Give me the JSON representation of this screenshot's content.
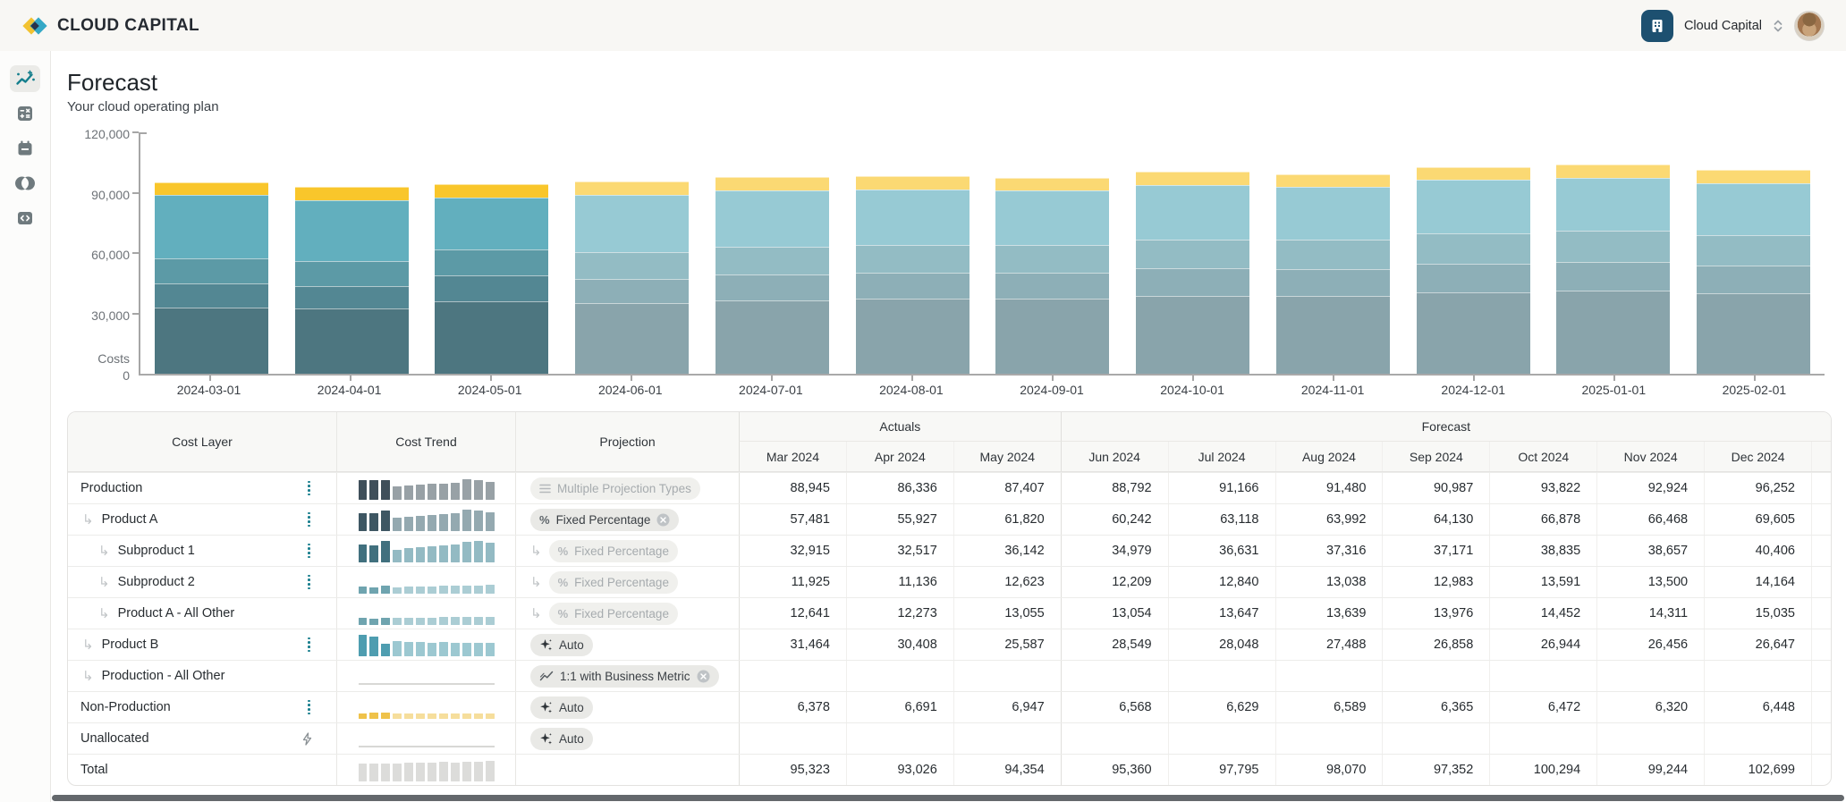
{
  "header": {
    "logo_text": "CLOUD CAPITAL",
    "org_selector": {
      "label": "Cloud Capital"
    },
    "brand_colors": {
      "yellow": "#F2C230",
      "teal": "#35A8C6",
      "navy": "#2A3349",
      "chip_blue": "#1d5070"
    }
  },
  "sidebar": {
    "items": [
      {
        "name": "forecast",
        "icon": "trend-sparkline-icon",
        "active": true
      },
      {
        "name": "calculator",
        "icon": "calculator-icon",
        "active": false
      },
      {
        "name": "calendar",
        "icon": "calendar-icon",
        "active": false
      },
      {
        "name": "overlap",
        "icon": "overlap-circles-icon",
        "active": false
      },
      {
        "name": "code",
        "icon": "code-icon",
        "active": false
      }
    ]
  },
  "page": {
    "title": "Forecast",
    "subtitle": "Your cloud operating plan"
  },
  "chart_data": {
    "type": "bar",
    "stacked": true,
    "x": [
      "2024-03-01",
      "2024-04-01",
      "2024-05-01",
      "2024-06-01",
      "2024-07-01",
      "2024-08-01",
      "2024-09-01",
      "2024-10-01",
      "2024-11-01",
      "2024-12-01",
      "2025-01-01",
      "2025-02-01"
    ],
    "series": [
      {
        "name": "Subproduct 1",
        "color": "#4D7680",
        "values": [
          32915,
          32517,
          36142,
          34979,
          36631,
          37316,
          37171,
          38835,
          38657,
          40406,
          41200,
          39900
        ]
      },
      {
        "name": "Subproduct 2",
        "color": "#538793",
        "values": [
          11925,
          11136,
          12623,
          12209,
          12840,
          13038,
          12983,
          13591,
          13500,
          14164,
          14450,
          13950
        ]
      },
      {
        "name": "Product A - All Other",
        "color": "#5C9AA6",
        "values": [
          12641,
          12273,
          13055,
          13054,
          13647,
          13639,
          13976,
          14452,
          14311,
          15035,
          15350,
          14850
        ]
      },
      {
        "name": "Product B",
        "color": "#62AFBE",
        "values": [
          31464,
          30408,
          25587,
          28549,
          28048,
          27488,
          26858,
          26944,
          26456,
          26647,
          26500,
          26100
        ]
      },
      {
        "name": "Non-Production",
        "color": "#F9C62B",
        "values": [
          6378,
          6691,
          6947,
          6568,
          6629,
          6589,
          6365,
          6472,
          6320,
          6448,
          6500,
          6400
        ]
      }
    ],
    "actual_months": 3,
    "forecast_opacity": 0.66,
    "ylabel": "Costs",
    "yticks": [
      0,
      30000,
      60000,
      90000,
      120000
    ],
    "ylim": [
      0,
      120000
    ],
    "grid": false,
    "legend": "none"
  },
  "table": {
    "column_headers": {
      "cost_layer": "Cost Layer",
      "cost_trend": "Cost Trend",
      "projection": "Projection"
    },
    "group_headers": {
      "actuals": "Actuals",
      "forecast": "Forecast"
    },
    "months": [
      "Mar 2024",
      "Apr 2024",
      "May 2024",
      "Jun 2024",
      "Jul 2024",
      "Aug 2024",
      "Sep 2024",
      "Oct 2024",
      "Nov 2024",
      "Dec 2024"
    ],
    "actual_month_count": 3,
    "rows": [
      {
        "label": "Production",
        "indent": 0,
        "menu": "kebab",
        "trend": {
          "kind": "bars",
          "dark": "#3F4F5A",
          "light": "#98A1A6",
          "values": [
            0.88,
            0.85,
            0.88,
            0.6,
            0.63,
            0.66,
            0.69,
            0.72,
            0.76,
            0.92,
            0.86,
            0.8
          ]
        },
        "projection": {
          "style": "muted",
          "icon": "stack",
          "label": "Multiple Projection Types",
          "closable": false,
          "inherited": false
        },
        "values": [
          "88,945",
          "86,336",
          "87,407",
          "88,792",
          "91,166",
          "91,480",
          "90,987",
          "93,822",
          "92,924",
          "96,252"
        ]
      },
      {
        "label": "Product A",
        "indent": 1,
        "menu": "kebab",
        "trend": {
          "kind": "bars",
          "dark": "#3E5763",
          "light": "#94A9B0",
          "values": [
            0.8,
            0.78,
            0.92,
            0.58,
            0.64,
            0.68,
            0.7,
            0.74,
            0.8,
            0.95,
            0.9,
            0.84
          ]
        },
        "projection": {
          "style": "active",
          "icon": "percent",
          "label": "Fixed Percentage",
          "closable": true,
          "inherited": false
        },
        "values": [
          "57,481",
          "55,927",
          "61,820",
          "60,242",
          "63,118",
          "63,992",
          "64,130",
          "66,878",
          "66,468",
          "69,605"
        ]
      },
      {
        "label": "Subproduct 1",
        "indent": 2,
        "menu": "kebab",
        "trend": {
          "kind": "bars",
          "dark": "#41707E",
          "light": "#93BAC3",
          "values": [
            0.78,
            0.76,
            0.95,
            0.55,
            0.62,
            0.68,
            0.7,
            0.74,
            0.8,
            0.92,
            0.95,
            0.86
          ]
        },
        "projection": {
          "style": "muted",
          "icon": "percent",
          "label": "Fixed Percentage",
          "closable": false,
          "inherited": true
        },
        "values": [
          "32,915",
          "32,517",
          "36,142",
          "34,979",
          "36,631",
          "37,316",
          "37,171",
          "38,835",
          "38,657",
          "40,406"
        ]
      },
      {
        "label": "Subproduct 2",
        "indent": 2,
        "menu": "kebab",
        "trend": {
          "kind": "bars",
          "dark": "#6FA4AF",
          "light": "#ABCDD4",
          "values": [
            0.3,
            0.26,
            0.34,
            0.28,
            0.3,
            0.31,
            0.31,
            0.33,
            0.33,
            0.36,
            0.35,
            0.37
          ]
        },
        "projection": {
          "style": "muted",
          "icon": "percent",
          "label": "Fixed Percentage",
          "closable": false,
          "inherited": true
        },
        "values": [
          "11,925",
          "11,136",
          "12,623",
          "12,209",
          "12,840",
          "13,038",
          "12,983",
          "13,591",
          "13,500",
          "14,164"
        ]
      },
      {
        "label": "Product A - All Other",
        "indent": 2,
        "menu": "none",
        "trend": {
          "kind": "bars",
          "dark": "#6FA4AF",
          "light": "#ABCDD4",
          "values": [
            0.3,
            0.28,
            0.32,
            0.3,
            0.31,
            0.31,
            0.32,
            0.33,
            0.33,
            0.36,
            0.34,
            0.36
          ]
        },
        "projection": {
          "style": "muted",
          "icon": "percent",
          "label": "Fixed Percentage",
          "closable": false,
          "inherited": true
        },
        "values": [
          "12,641",
          "12,273",
          "13,055",
          "13,054",
          "13,647",
          "13,639",
          "13,976",
          "14,452",
          "14,311",
          "15,035"
        ]
      },
      {
        "label": "Product B",
        "indent": 1,
        "menu": "kebab",
        "trend": {
          "kind": "bars",
          "dark": "#4E9DB0",
          "light": "#9CC8D1",
          "values": [
            0.95,
            0.88,
            0.55,
            0.66,
            0.64,
            0.62,
            0.6,
            0.61,
            0.59,
            0.6,
            0.58,
            0.59
          ]
        },
        "projection": {
          "style": "active",
          "icon": "sparkle",
          "label": "Auto",
          "closable": false,
          "inherited": false
        },
        "values": [
          "31,464",
          "30,408",
          "25,587",
          "28,549",
          "28,048",
          "27,488",
          "26,858",
          "26,944",
          "26,456",
          "26,647"
        ]
      },
      {
        "label": "Production - All Other",
        "indent": 1,
        "menu": "none",
        "trend": {
          "kind": "flat"
        },
        "projection": {
          "style": "active",
          "icon": "metric",
          "label": "1:1 with Business Metric",
          "closable": true,
          "inherited": false
        },
        "values": [
          "",
          "",
          "",
          "",
          "",
          "",
          "",
          "",
          "",
          ""
        ]
      },
      {
        "label": "Non-Production",
        "indent": 0,
        "menu": "kebab",
        "trend": {
          "kind": "bars",
          "dark": "#EFC24A",
          "light": "#F6DE9C",
          "values": [
            0.24,
            0.26,
            0.27,
            0.23,
            0.24,
            0.24,
            0.22,
            0.23,
            0.22,
            0.22,
            0.21,
            0.22
          ]
        },
        "projection": {
          "style": "active",
          "icon": "sparkle",
          "label": "Auto",
          "closable": false,
          "inherited": false
        },
        "values": [
          "6,378",
          "6,691",
          "6,947",
          "6,568",
          "6,629",
          "6,589",
          "6,365",
          "6,472",
          "6,320",
          "6,448"
        ]
      },
      {
        "label": "Unallocated",
        "indent": 0,
        "menu": "bolt",
        "trend": {
          "kind": "flat"
        },
        "projection": {
          "style": "active",
          "icon": "sparkle",
          "label": "Auto",
          "closable": false,
          "inherited": false
        },
        "values": [
          "",
          "",
          "",
          "",
          "",
          "",
          "",
          "",
          "",
          ""
        ]
      },
      {
        "label": "Total",
        "indent": 0,
        "menu": "none",
        "trend": {
          "kind": "bars",
          "dark": "#DCDCDA",
          "light": "#DCDCDA",
          "values": [
            0.8,
            0.77,
            0.79,
            0.8,
            0.82,
            0.82,
            0.81,
            0.85,
            0.83,
            0.88,
            0.86,
            0.9
          ]
        },
        "projection": null,
        "values": [
          "95,323",
          "93,026",
          "94,354",
          "95,360",
          "97,795",
          "98,070",
          "97,352",
          "100,294",
          "99,244",
          "102,699"
        ]
      }
    ]
  }
}
